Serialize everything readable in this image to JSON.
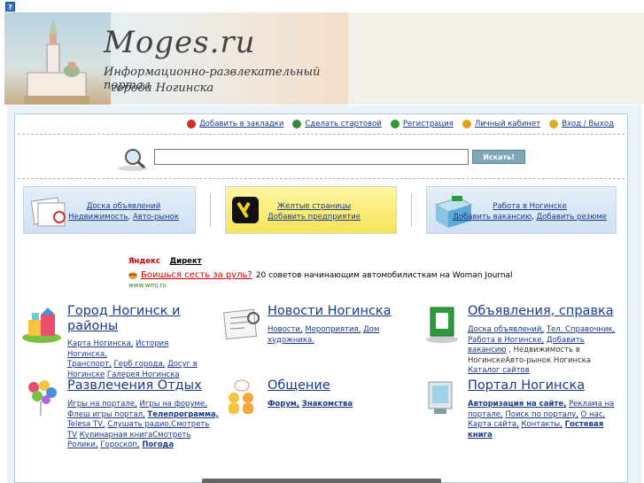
{
  "help": {
    "label": "?"
  },
  "banner": {
    "logo": "Moges.ru",
    "subtitle_line1": "Информационно-развлекательный портал",
    "subtitle_line2": "города Ногинска"
  },
  "toplinks": [
    {
      "label": "Добавить в закладки",
      "icon": "heart-icon",
      "color": "#d42a2a"
    },
    {
      "label": "Сделать стартовой",
      "icon": "globe-icon",
      "color": "#3c8a3c"
    },
    {
      "label": "Регистрация",
      "icon": "check-icon",
      "color": "#2e9a2e"
    },
    {
      "label": "Личный кабинет",
      "icon": "user-icon",
      "color": "#e4a020"
    },
    {
      "label": "Вход / Выход",
      "icon": "key-icon",
      "color": "#d8b020"
    }
  ],
  "search": {
    "value": "",
    "button": "Искать!"
  },
  "promos": [
    {
      "title": "Доска объявлений",
      "links": [
        "Недвижимость",
        "Авто-рынок"
      ]
    },
    {
      "title": "Желтые страницы",
      "links": [
        "Добавить предприятие"
      ]
    },
    {
      "title": "Работа в Ногинске",
      "links": [
        "Добавить вакансию",
        "Добавить резюме"
      ]
    }
  ],
  "ad": {
    "yandex": "Яндекс",
    "direkt": "Директ",
    "headline": "Боишься сесть за руль?",
    "body": "20 советов начинающим автомобилисткам на Woman Journal",
    "url": "www.wmj.ru"
  },
  "categories": [
    {
      "title": "Город Ногинск и районы",
      "links": [
        "Карта Ногинска,",
        "История Ногинска,",
        "Транспорт,",
        "Герб города,",
        "Досуг в Ногинске",
        "Галерея Ногинска"
      ]
    },
    {
      "title": "Новости Ногинска",
      "links": [
        "Новости,",
        "Мероприятия,",
        "Дом художника."
      ]
    },
    {
      "title": "Объявления, справка",
      "links": [
        "Доска объявлений,",
        "Тел. Справочник,",
        "Работа в Ногинске,",
        "Добавить вакансию",
        ", Недвижимость в Ногинске",
        "Авто-рынок Ногинска",
        "Каталог сайтов"
      ]
    },
    {
      "title": "Развлечения Отдых",
      "links": [
        "Игры на портале,",
        "Игры на форуме,",
        "Флеш игры портал,",
        "Телепрограмма,",
        "Telesa TV,",
        "Слушать радио,",
        "Смотреть TV",
        "Кулинарная книга",
        "Смотреть Ролики,",
        "Гороскоп,",
        "Погода"
      ]
    },
    {
      "title": "Общение",
      "links": [
        "Форум,",
        "Знакомства"
      ]
    },
    {
      "title": "Портал Ногинска",
      "links": [
        "Авторизация на сайте,",
        "Реклама на портале,",
        "Поиск по порталу,",
        "О нас,",
        "Карта сайта,",
        "Контакты,",
        "Гостевая книга"
      ]
    }
  ]
}
